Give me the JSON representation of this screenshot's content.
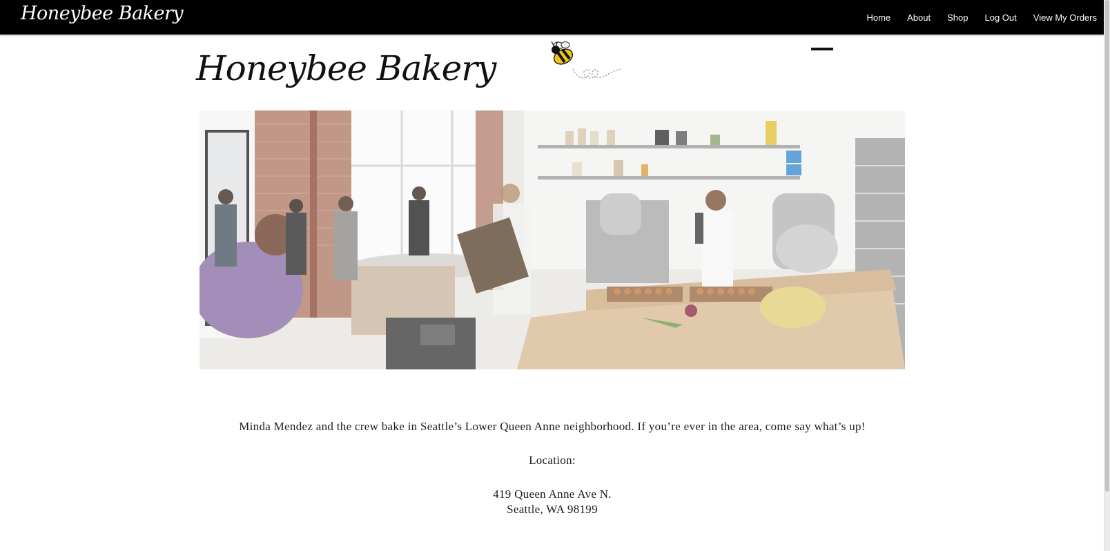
{
  "header": {
    "brand": "Honeybee Bakery",
    "nav": [
      "Home",
      "About",
      "Shop",
      "Log Out",
      "View My Orders"
    ]
  },
  "page": {
    "title": "Honeybee Bakery",
    "intro": "Minda Mendez and the crew bake in Seattle’s Lower Queen Anne neighborhood. If you’re ever in the area, come say what’s up!",
    "location_label": "Location:",
    "address_line1": "419 Queen Anne Ave N.",
    "address_line2": "Seattle, WA 98199"
  },
  "icons": {
    "logo": "bee-icon",
    "menu": "hamburger-menu-icon"
  },
  "colors": {
    "topbar": "#000000",
    "page_background": "#ffffff",
    "text": "#1c1c1c",
    "bee_yellow": "#f5c518"
  }
}
